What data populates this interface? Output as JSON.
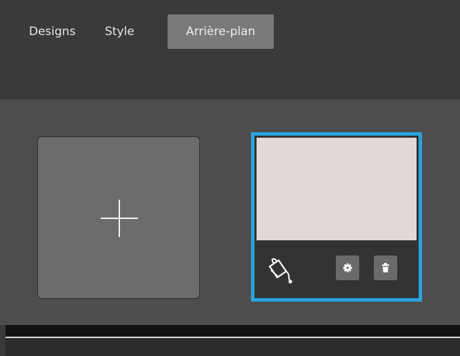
{
  "tabs": [
    {
      "label": "Designs",
      "active": false
    },
    {
      "label": "Style",
      "active": false
    },
    {
      "label": "Arrière-plan",
      "active": true
    }
  ],
  "background_panel": {
    "selected_color": "#e3d8d8",
    "selection_border_color": "#2aa3de",
    "add_icon": "plus-icon",
    "tile_icons": [
      "paint-bucket-icon",
      "gear-icon",
      "trash-icon"
    ]
  }
}
